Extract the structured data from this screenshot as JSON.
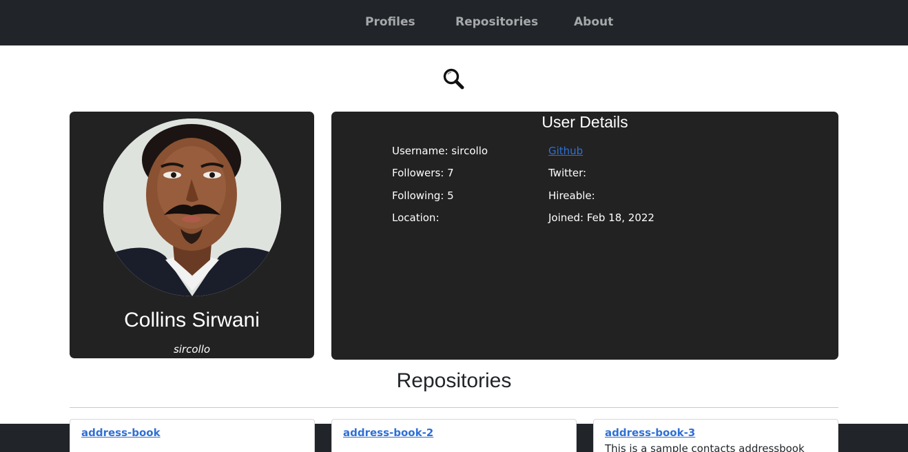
{
  "nav": {
    "items": [
      {
        "label": "Profiles"
      },
      {
        "label": "Repositories"
      },
      {
        "label": "About"
      }
    ]
  },
  "search": {
    "icon": "search-icon"
  },
  "profile": {
    "name": "Collins Sirwani",
    "login": "sircollo"
  },
  "details": {
    "title": "User Details",
    "username": "Username: sircollo",
    "followers": "Followers: 7",
    "following": "Following: 5",
    "location": "Location:",
    "github": "Github",
    "twitter": "Twitter:",
    "hireable": "Hireable:",
    "joined": "Joined: Feb 18, 2022"
  },
  "repositories": {
    "title": "Repositories",
    "items": [
      {
        "name": "address-book",
        "description": ""
      },
      {
        "name": "address-book-2",
        "description": ""
      },
      {
        "name": "address-book-3",
        "description": "This is a sample contacts addressbook"
      }
    ]
  },
  "colors": {
    "navbar": "#212529",
    "card": "#222222",
    "link": "#2f6fd6"
  }
}
